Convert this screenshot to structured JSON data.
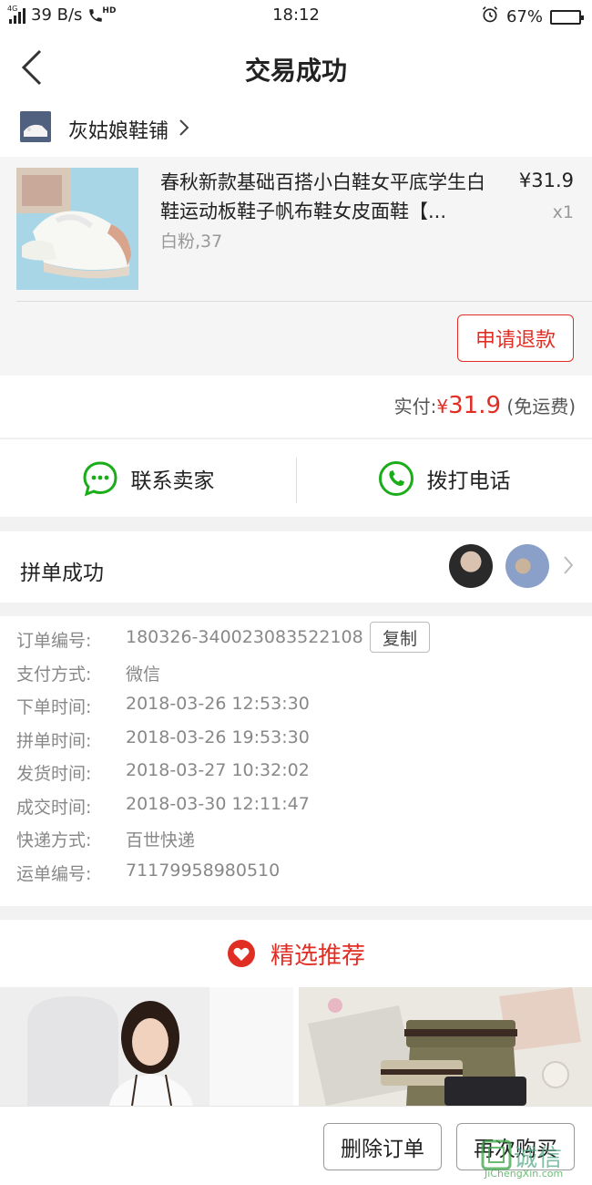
{
  "status_bar": {
    "network": "4G",
    "speed": "39 B/s",
    "call_badge": "HD",
    "time": "18:12",
    "battery": "67%",
    "battery_level": 0.67
  },
  "header": {
    "title": "交易成功"
  },
  "shop": {
    "name": "灰姑娘鞋铺"
  },
  "product": {
    "title": "春秋新款基础百搭小白鞋女平底学生白鞋运动板鞋子帆布鞋女皮面鞋【...",
    "spec": "白粉,37",
    "price": "¥31.9",
    "qty": "x1",
    "refund_label": "申请退款"
  },
  "payment": {
    "label": "实付:",
    "currency": "¥",
    "amount": "31.9",
    "note": "(免运费)"
  },
  "contact": {
    "seller_label": "联系卖家",
    "phone_label": "拨打电话"
  },
  "group": {
    "label": "拼单成功"
  },
  "details": {
    "copy_label": "复制",
    "rows": [
      {
        "label": "订单编号:",
        "value": "180326-340023083522108"
      },
      {
        "label": "支付方式:",
        "value": "微信"
      },
      {
        "label": "下单时间:",
        "value": "2018-03-26 12:53:30"
      },
      {
        "label": "拼单时间:",
        "value": "2018-03-26 19:53:30"
      },
      {
        "label": "发货时间:",
        "value": "2018-03-27 10:32:02"
      },
      {
        "label": "成交时间:",
        "value": "2018-03-30 12:11:47"
      },
      {
        "label": "快递方式:",
        "value": "百世快递"
      },
      {
        "label": "运单编号:",
        "value": "71179958980510"
      }
    ]
  },
  "recommend": {
    "title": "精选推荐"
  },
  "bottom": {
    "delete_label": "删除订单",
    "rebuy_label": "再次购买"
  },
  "watermark": {
    "cn": "诚信",
    "url": "JiChengXin.com"
  },
  "colors": {
    "accent": "#e02e24",
    "wechat_green": "#1aad19"
  }
}
